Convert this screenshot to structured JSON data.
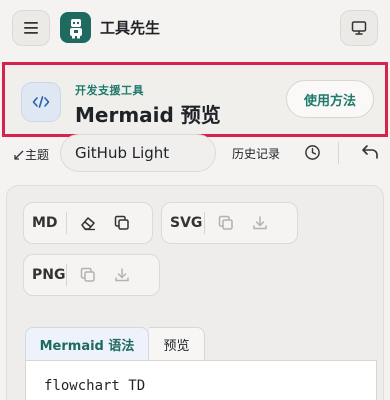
{
  "app": {
    "brand": "工具先生"
  },
  "tool": {
    "subtitle": "开发支援工具",
    "title": "Mermaid 预览",
    "usage_label": "使用方法"
  },
  "toolbar": {
    "theme_label": "主题",
    "theme_value": "GitHub Light",
    "history_label": "历史记录"
  },
  "exports": {
    "md_label": "MD",
    "svg_label": "SVG",
    "png_label": "PNG"
  },
  "editor": {
    "tabs": [
      {
        "label": "Mermaid 语法",
        "active": true
      },
      {
        "label": "预览",
        "active": false
      }
    ],
    "code_first_line": "flowchart TD"
  },
  "colors": {
    "accent": "#1e7a6b",
    "highlight_border": "#d6224c"
  },
  "icons": {
    "menu": "hamburger-menu-icon",
    "logo": "robot-logo-icon",
    "monitor": "monitor-icon",
    "code": "code-brackets-icon",
    "clock": "clock-icon",
    "undo": "undo-icon",
    "eraser": "eraser-icon",
    "copy": "copy-icon",
    "download": "download-icon"
  }
}
